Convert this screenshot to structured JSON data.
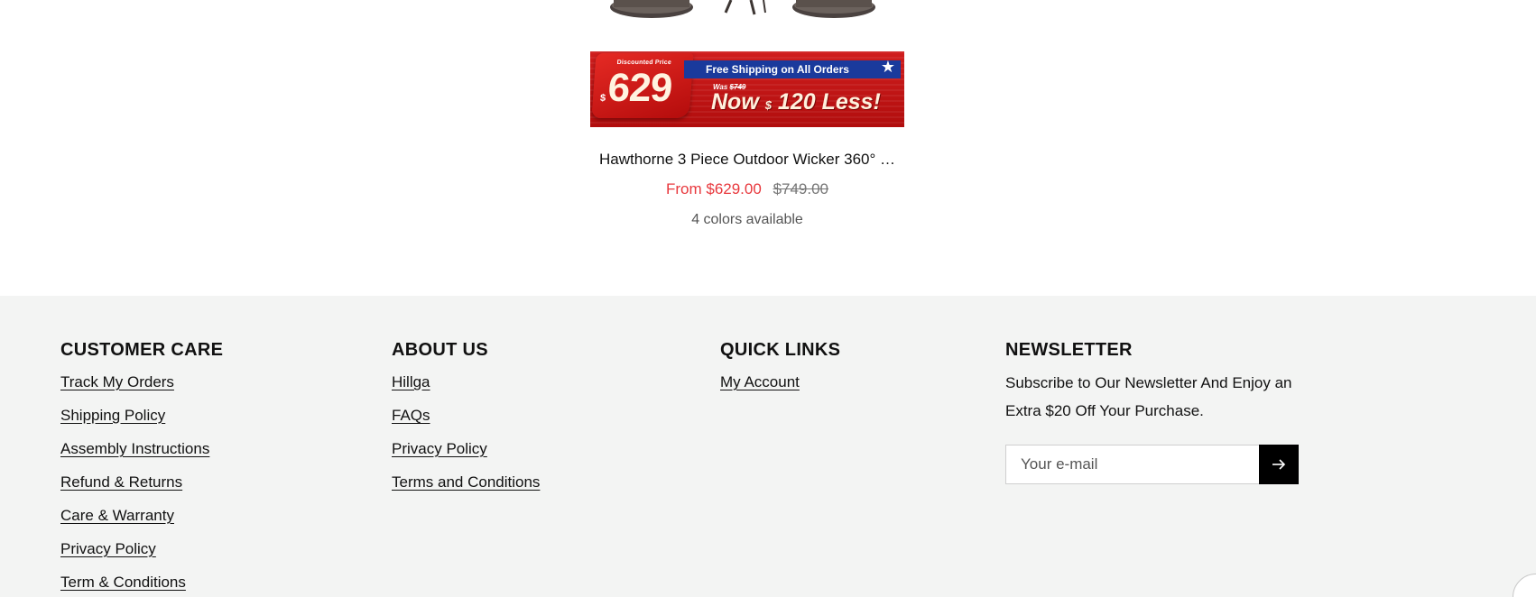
{
  "product": {
    "title": "Hawthorne 3 Piece Outdoor Wicker 360° …",
    "sale_price": "From $629.00",
    "compare_price": "$749.00",
    "colors_available": "4 colors available",
    "banner": {
      "price_label": "Discounted Price",
      "currency": "$",
      "price": "629",
      "shipping_text": "Free Shipping on All Orders",
      "was_label": "Was",
      "was_price": "$749",
      "now_prefix": "Now",
      "now_currency": "$",
      "now_amount": "120 Less!"
    }
  },
  "footer": {
    "customer_care": {
      "heading": "CUSTOMER CARE",
      "links": [
        "Track My Orders",
        "Shipping Policy",
        "Assembly Instructions",
        "Refund & Returns",
        "Care & Warranty",
        "Privacy Policy",
        "Term & Conditions"
      ]
    },
    "about_us": {
      "heading": "ABOUT US",
      "links": [
        "Hillga",
        "FAQs",
        "Privacy Policy",
        "Terms and Conditions"
      ]
    },
    "quick_links": {
      "heading": "QUICK LINKS",
      "links": [
        "My Account"
      ]
    },
    "newsletter": {
      "heading": "NEWSLETTER",
      "text": "Subscribe to Our Newsletter And Enjoy an Extra $20 Off Your Purchase.",
      "placeholder": "Your e-mail",
      "submit_icon": "arrow-right-icon"
    }
  },
  "colors": {
    "sale_price": "#e8383d",
    "footer_bg": "#f3f4f3",
    "banner_red": "#c4151a",
    "banner_blue": "#1a3a9c"
  }
}
